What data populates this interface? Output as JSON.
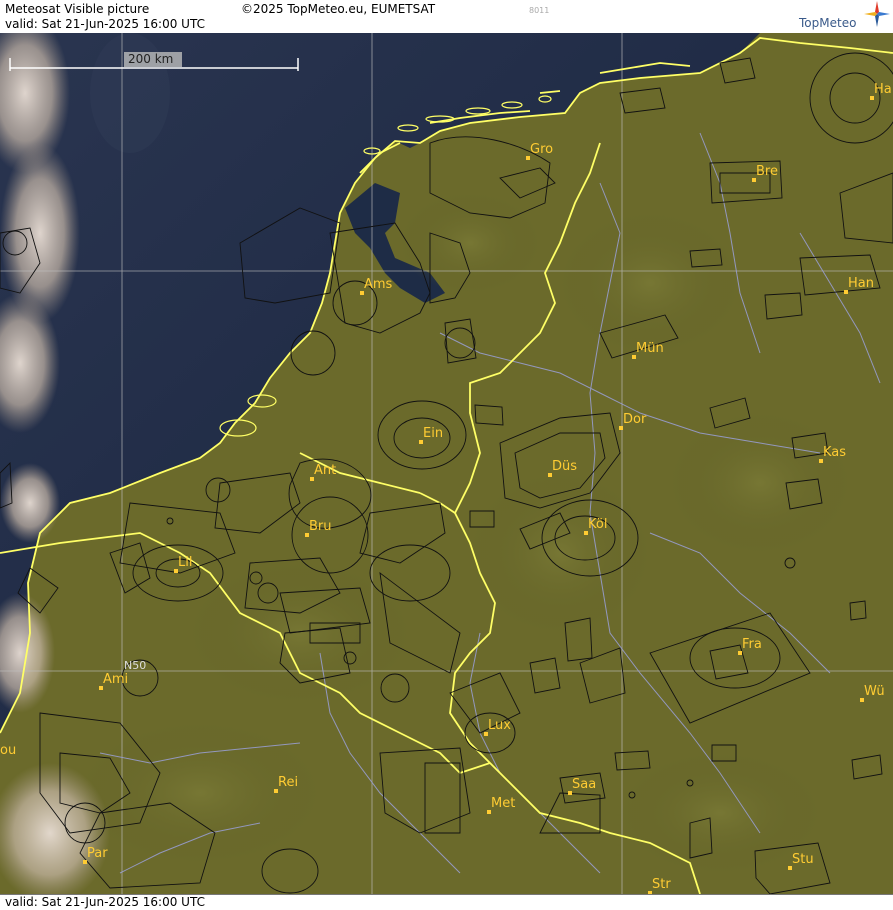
{
  "header": {
    "title": "Meteosat Visible picture",
    "copyright": "©2025 TopMeteo.eu, EUMETSAT",
    "code": "8011",
    "valid": "valid:  Sat  21-Jun-2025  16:00 UTC",
    "logo_text": "TopMeteo"
  },
  "footer": {
    "valid": "valid:  Sat  21-Jun-2025  16:00 UTC"
  },
  "map": {
    "scale_label": "200 km",
    "grid_label": "N50",
    "colors": {
      "land": "#6b6a2b",
      "sea": "#1c2840",
      "coast_border": "#ffff66",
      "airspace": "#111111",
      "rivers": "#9aa0d8",
      "grid": "#bfbfbf",
      "city": "#ffcc33"
    },
    "cities": [
      {
        "label": "Gro"
      },
      {
        "label": "Bre"
      },
      {
        "label": "Ha"
      },
      {
        "label": "Ams"
      },
      {
        "label": "Han"
      },
      {
        "label": "Mün"
      },
      {
        "label": "Ein"
      },
      {
        "label": "Dor"
      },
      {
        "label": "Kas"
      },
      {
        "label": "Ant"
      },
      {
        "label": "Düs"
      },
      {
        "label": "Bru"
      },
      {
        "label": "Köl"
      },
      {
        "label": "Lil"
      },
      {
        "label": "Fra"
      },
      {
        "label": "Ami"
      },
      {
        "label": "Wü"
      },
      {
        "label": "Lux"
      },
      {
        "label": "Rei"
      },
      {
        "label": "Saa"
      },
      {
        "label": "Met"
      },
      {
        "label": "Par"
      },
      {
        "label": "Stu"
      },
      {
        "label": "Str"
      },
      {
        "label": "ou"
      }
    ]
  }
}
